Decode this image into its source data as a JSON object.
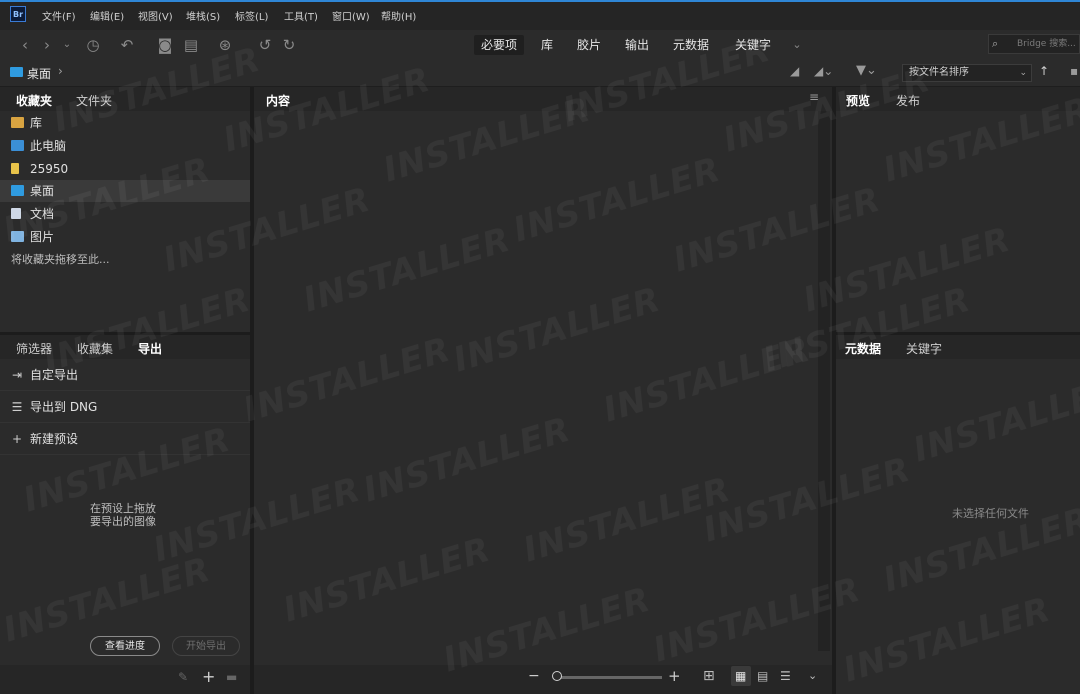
{
  "app": {
    "logo": "Br"
  },
  "menu": [
    "文件(F)",
    "编辑(E)",
    "视图(V)",
    "堆栈(S)",
    "标签(L)",
    "工具(T)",
    "窗口(W)",
    "帮助(H)"
  ],
  "workspaces": [
    {
      "label": "必要项",
      "active": true
    },
    {
      "label": "库",
      "active": false
    },
    {
      "label": "胶片",
      "active": false
    },
    {
      "label": "输出",
      "active": false
    },
    {
      "label": "元数据",
      "active": false
    },
    {
      "label": "关键字",
      "active": false
    }
  ],
  "search": {
    "placeholder": "Bridge 搜索..."
  },
  "path": {
    "current": "桌面",
    "sep": "›"
  },
  "sort": {
    "label": "按文件名排序",
    "arrow": "↑"
  },
  "left_top": {
    "tabs": [
      "收藏夹",
      "文件夹"
    ],
    "items": [
      {
        "label": "库",
        "color": "#d9a441"
      },
      {
        "label": "此电脑",
        "color": "#3b8fd6"
      },
      {
        "label": "25950",
        "color": "#e8c34a"
      },
      {
        "label": "桌面",
        "color": "#2f9be0",
        "selected": true
      },
      {
        "label": "文档",
        "color": "#cfd8e6"
      },
      {
        "label": "图片",
        "color": "#7fb3e0"
      }
    ],
    "hint": "将收藏夹拖移至此..."
  },
  "left_bottom": {
    "tabs": [
      "筛选器",
      "收藏集",
      "导出"
    ],
    "items": [
      {
        "label": "自定导出",
        "icon": "⇥"
      },
      {
        "label": "导出到 DNG",
        "icon": "☰"
      },
      {
        "label": "新建预设",
        "icon": "+"
      }
    ],
    "drop_hint_1": "在预设上拖放",
    "drop_hint_2": "要导出的图像",
    "btn_progress": "查看进度",
    "btn_start": "开始导出"
  },
  "content": {
    "title": "内容"
  },
  "right_top": {
    "tabs": [
      "预览",
      "发布"
    ]
  },
  "right_bottom": {
    "tabs": [
      "元数据",
      "关键字"
    ],
    "empty": "未选择任何文件"
  },
  "bottom": {
    "minus": "−",
    "plus": "+"
  },
  "watermark": "INSTALLER",
  "colors": {
    "accent": "#2f86d6",
    "panel": "#2b2b2b",
    "header": "#262626",
    "selected": "#3a3a3a"
  }
}
